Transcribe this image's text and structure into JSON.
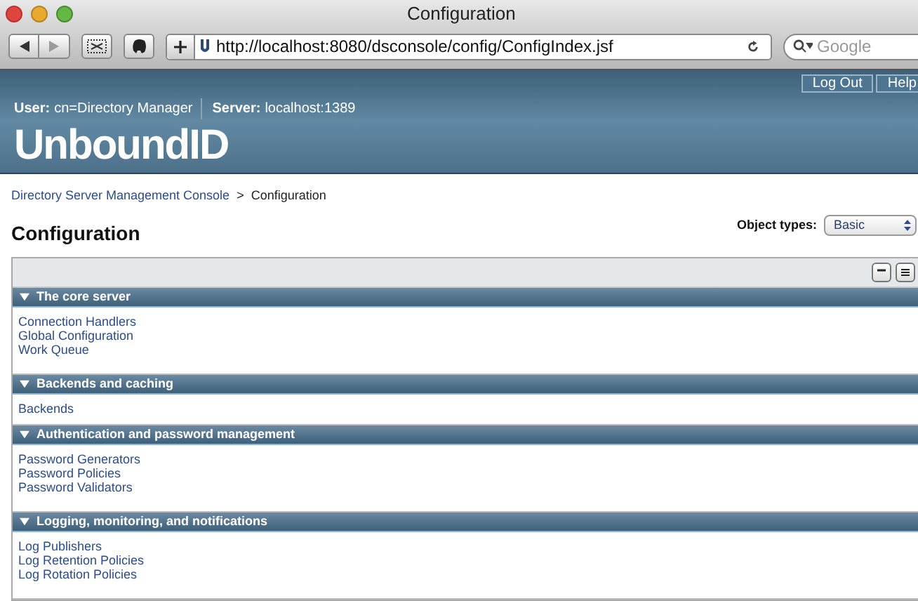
{
  "window": {
    "title": "Configuration"
  },
  "toolbar": {
    "url": "http://localhost:8080/dsconsole/config/ConfigIndex.jsf",
    "search": {
      "placeholder": "Google"
    }
  },
  "header": {
    "buttons": [
      "Log Out",
      "Help"
    ],
    "user_label": "User:",
    "user": "cn=Directory Manager",
    "server_label": "Server:",
    "server": "localhost:1389",
    "logo": "UnboundID"
  },
  "breadcrumb": [
    {
      "label": "Directory Server Management Console",
      "link": true
    },
    {
      "label": ">",
      "link": false
    },
    {
      "label": "Configuration",
      "link": false
    }
  ],
  "page_title": "Configuration",
  "object_types": {
    "label": "Object types:",
    "value": "Basic"
  },
  "sections": [
    {
      "title": "The core server",
      "expanded": true,
      "items": [
        "Connection Handlers",
        "Global Configuration",
        "Work Queue"
      ]
    },
    {
      "title": "Backends and caching",
      "expanded": true,
      "items": [
        "Backends"
      ]
    },
    {
      "title": "Authentication and password management",
      "expanded": true,
      "items": [
        "Password Generators",
        "Password Policies",
        "Password Validators"
      ]
    },
    {
      "title": "Logging, monitoring, and notifications",
      "expanded": true,
      "items": [
        "Log Publishers",
        "Log Retention Policies",
        "Log Rotation Policies"
      ]
    }
  ]
}
